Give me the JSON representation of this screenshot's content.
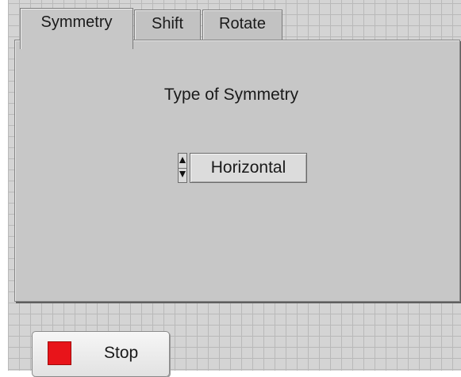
{
  "tabs": [
    {
      "label": "Symmetry",
      "active": true
    },
    {
      "label": "Shift",
      "active": false
    },
    {
      "label": "Rotate",
      "active": false
    }
  ],
  "symmetry": {
    "label": "Type of Symmetry",
    "value": "Horizontal"
  },
  "stop_button": {
    "label": "Stop",
    "indicator_color": "#e8141a"
  },
  "icons": {
    "spinner_up": "triangle-up-icon",
    "spinner_down": "triangle-down-icon"
  }
}
